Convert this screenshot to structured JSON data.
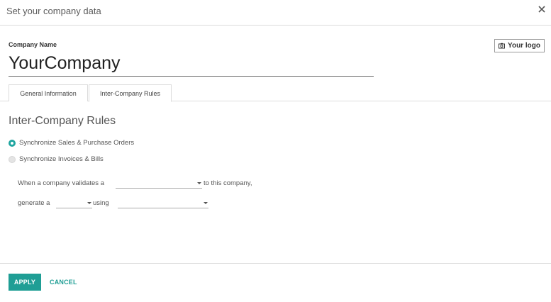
{
  "dialog": {
    "title": "Set your company data",
    "close_icon": "close-icon"
  },
  "company": {
    "label": "Company Name",
    "name": "YourCompany"
  },
  "logo_button": {
    "icon": "camera-icon",
    "label": "Your logo"
  },
  "tabs": [
    {
      "label": "General Information",
      "active": false
    },
    {
      "label": "Inter-Company Rules",
      "active": true
    }
  ],
  "rules": {
    "title": "Inter-Company Rules",
    "options": [
      {
        "label": "Synchronize Sales & Purchase Orders",
        "checked": true
      },
      {
        "label": "Synchronize Invoices & Bills",
        "checked": false
      }
    ],
    "when_text": "When a company validates a",
    "to_text": "to this company,",
    "generate_text": "generate a",
    "using_text": "using",
    "validates_select_value": "",
    "generate_select_value": "",
    "using_select_value": ""
  },
  "footer": {
    "apply_label": "APPLY",
    "cancel_label": "CANCEL"
  },
  "colors": {
    "accent": "#1f9e95",
    "radio_checked": "#1fa5a0",
    "border": "#dcdcdc"
  }
}
